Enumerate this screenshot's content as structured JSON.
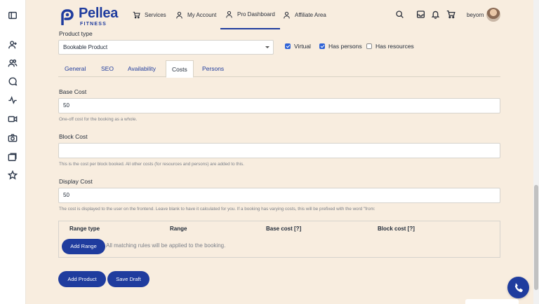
{
  "brand": {
    "name": "Pellea",
    "sub": "FITNESS",
    "color": "#1f3c9e"
  },
  "nav": [
    {
      "label": "Services",
      "icon": "cart-icon"
    },
    {
      "label": "My Account",
      "icon": "user-icon"
    },
    {
      "label": "Pro Dashboard",
      "icon": "user-icon",
      "active": true
    },
    {
      "label": "Affiliate Area",
      "icon": "user-icon"
    }
  ],
  "user": {
    "name": "beyorn"
  },
  "sidebar_icons": [
    "panel-toggle-icon",
    "user-plus-icon",
    "users-icon",
    "chat-icon",
    "activity-icon",
    "video-icon",
    "camera-icon",
    "gallery-icon",
    "star-icon"
  ],
  "product_type": {
    "label": "Product type",
    "value": "Bookable Product"
  },
  "options": {
    "virtual": "Virtual",
    "has_persons": "Has persons",
    "has_resources": "Has resources",
    "virtual_checked": true,
    "has_persons_checked": true,
    "has_resources_checked": false
  },
  "tabs": [
    "General",
    "SEO",
    "Availability",
    "Costs",
    "Persons"
  ],
  "active_tab": "Costs",
  "base_cost": {
    "label": "Base Cost",
    "value": "50",
    "help": "One-off cost for the booking as a whole."
  },
  "block_cost": {
    "label": "Block Cost",
    "value": "",
    "help": "This is the cost per block booked. All other costs (for resources and persons) are added to this."
  },
  "display_cost": {
    "label": "Display Cost",
    "value": "50",
    "help": "The cost is displayed to the user on the frontend. Leave blank to have it calculated for you. If a booking has varying costs, this will be prefixed with the word \"from:"
  },
  "ranges": {
    "headers": [
      "Range type",
      "Range",
      "Base cost [?]",
      "Block cost [?]"
    ],
    "add_label": "Add Range",
    "note": "All matching rules will be applied to the booking."
  },
  "actions": {
    "add_product": "Add Product",
    "save_draft": "Save Draft"
  }
}
